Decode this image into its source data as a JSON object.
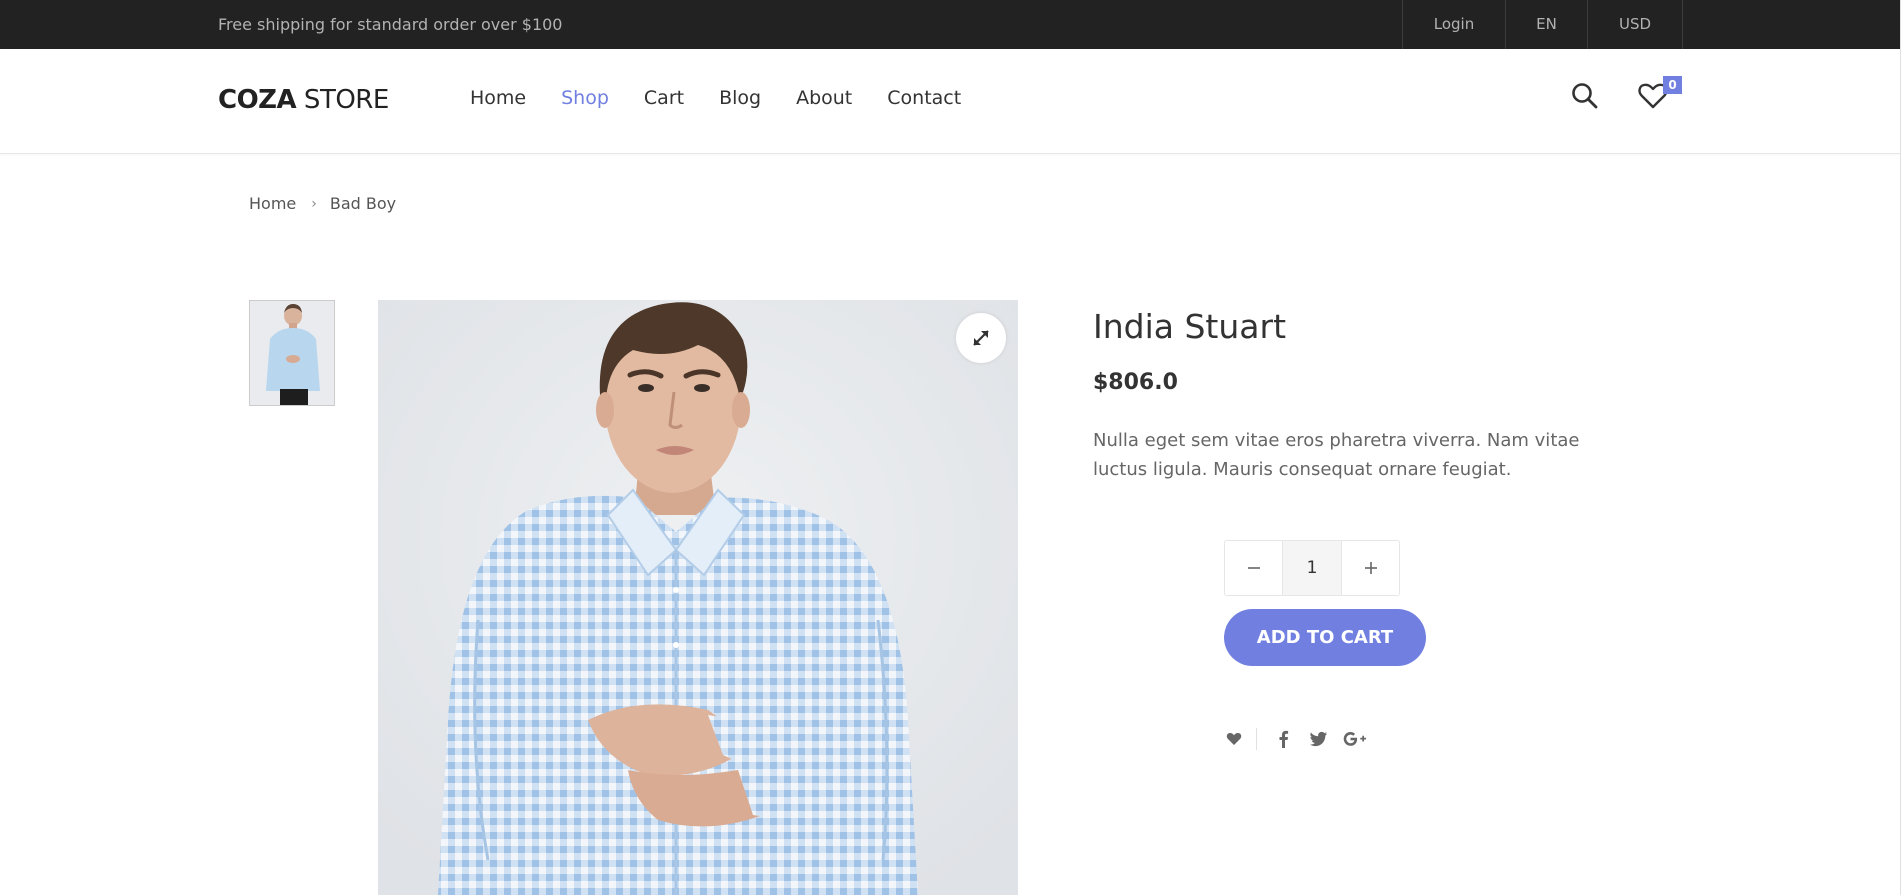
{
  "topbar": {
    "shipping_text": "Free shipping for standard order over $100",
    "login": "Login",
    "language": "EN",
    "currency": "USD"
  },
  "header": {
    "logo_bold": "COZA",
    "logo_rest": " STORE",
    "nav": [
      {
        "label": "Home"
      },
      {
        "label": "Shop"
      },
      {
        "label": "Cart"
      },
      {
        "label": "Blog"
      },
      {
        "label": "About"
      },
      {
        "label": "Contact"
      }
    ],
    "active_nav": "Shop",
    "wishlist_count": "0",
    "accent_color": "#717fe0"
  },
  "breadcrumb": {
    "home": "Home",
    "current": "Bad Boy"
  },
  "product": {
    "title": "India Stuart",
    "price": "$806.0",
    "description": "Nulla eget sem vitae eros pharetra viverra. Nam vitae luctus ligula. Mauris consequat ornare feugiat.",
    "quantity": "1",
    "add_to_cart": "ADD TO CART"
  },
  "icons": {
    "search": "search-icon",
    "wishlist": "heart-icon",
    "expand": "expand-icon",
    "minus": "minus-icon",
    "plus": "plus-icon",
    "facebook": "facebook-icon",
    "twitter": "twitter-icon",
    "google_plus": "google-plus-icon"
  }
}
